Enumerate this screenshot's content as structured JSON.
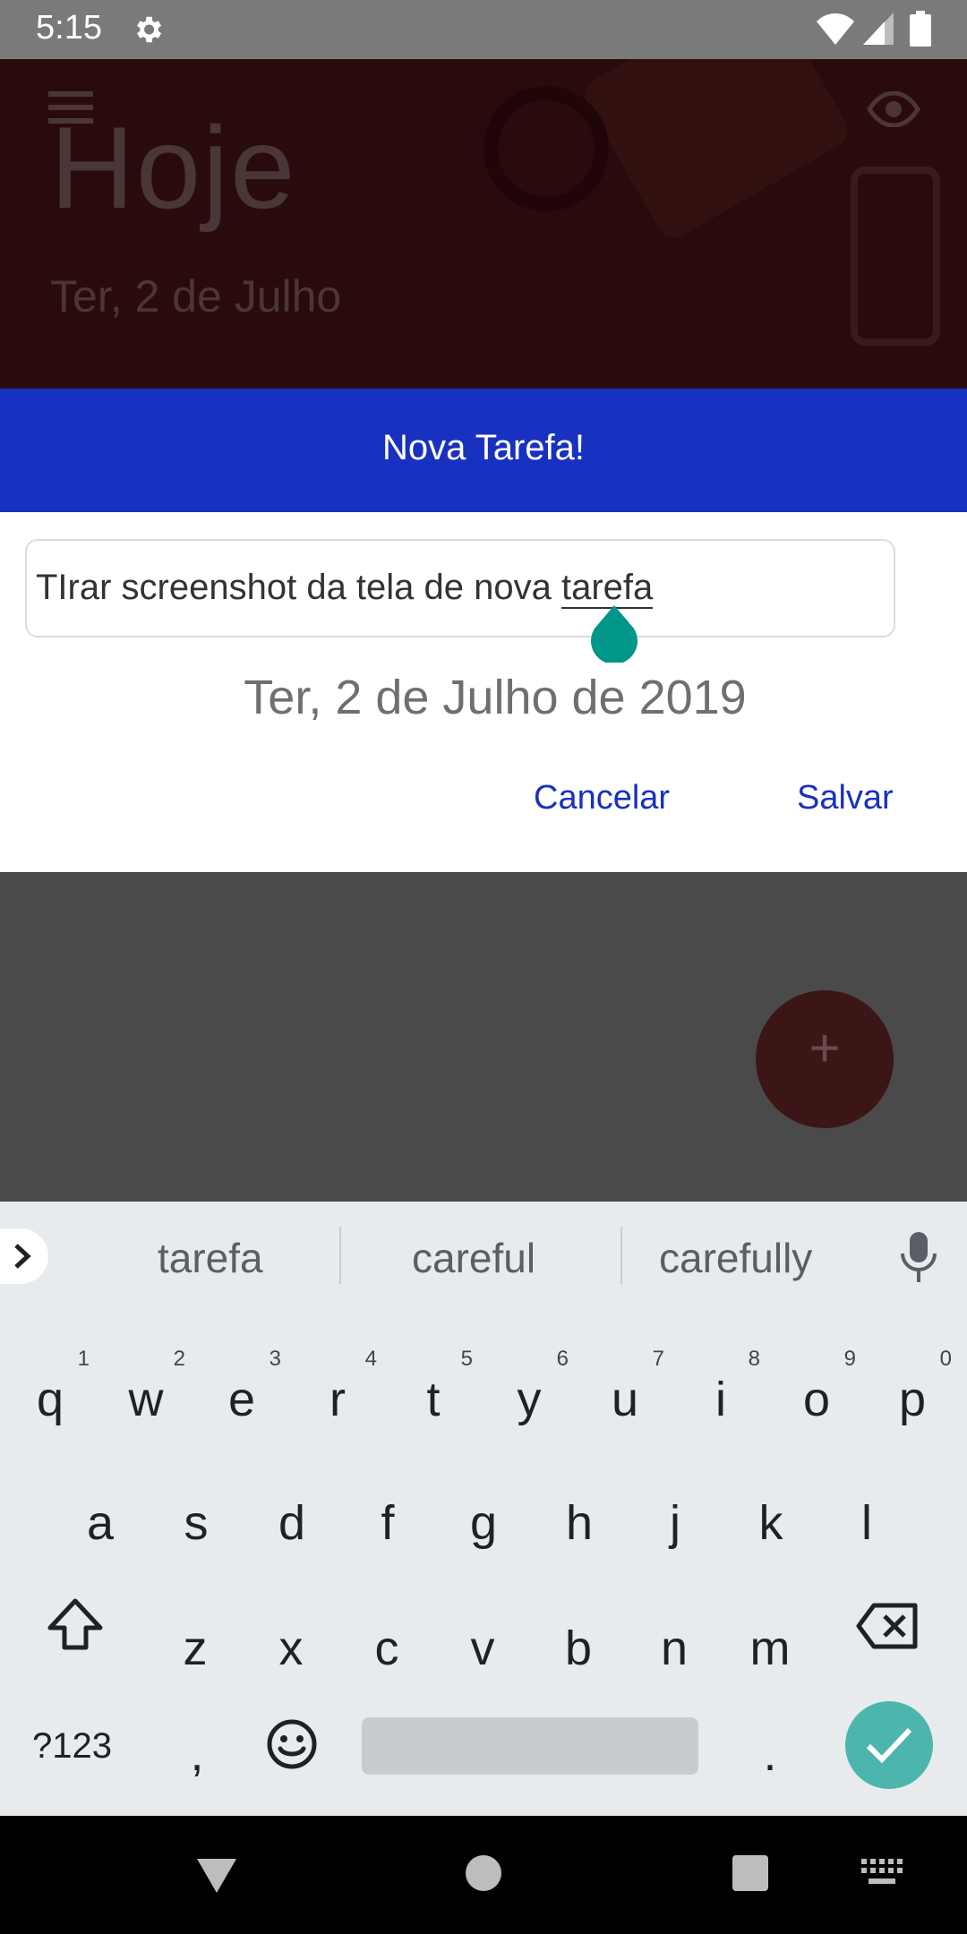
{
  "status_bar": {
    "time": "5:15"
  },
  "header": {
    "title": "Hoje",
    "date": "Ter, 2 de Julho"
  },
  "dialog": {
    "title": "Nova Tarefa!",
    "task_value_prefix": "TIrar screenshot da tela de nova ",
    "task_value_word": "tarefa",
    "date": "Ter, 2 de Julho de 2019",
    "cancel_label": "Cancelar",
    "save_label": "Salvar"
  },
  "fab": {
    "label": "+"
  },
  "keyboard": {
    "suggestions": [
      "tarefa",
      "careful",
      "carefully"
    ],
    "row1": [
      {
        "ch": "q",
        "hint": "1"
      },
      {
        "ch": "w",
        "hint": "2"
      },
      {
        "ch": "e",
        "hint": "3"
      },
      {
        "ch": "r",
        "hint": "4"
      },
      {
        "ch": "t",
        "hint": "5"
      },
      {
        "ch": "y",
        "hint": "6"
      },
      {
        "ch": "u",
        "hint": "7"
      },
      {
        "ch": "i",
        "hint": "8"
      },
      {
        "ch": "o",
        "hint": "9"
      },
      {
        "ch": "p",
        "hint": "0"
      }
    ],
    "row2": [
      "a",
      "s",
      "d",
      "f",
      "g",
      "h",
      "j",
      "k",
      "l"
    ],
    "row3": [
      "z",
      "x",
      "c",
      "v",
      "b",
      "n",
      "m"
    ],
    "symbols_label": "?123",
    "comma": ",",
    "period": "."
  },
  "colors": {
    "dialog_accent": "#1831c1",
    "cursor_handle": "#009688",
    "enter_key": "#4db6ac"
  }
}
